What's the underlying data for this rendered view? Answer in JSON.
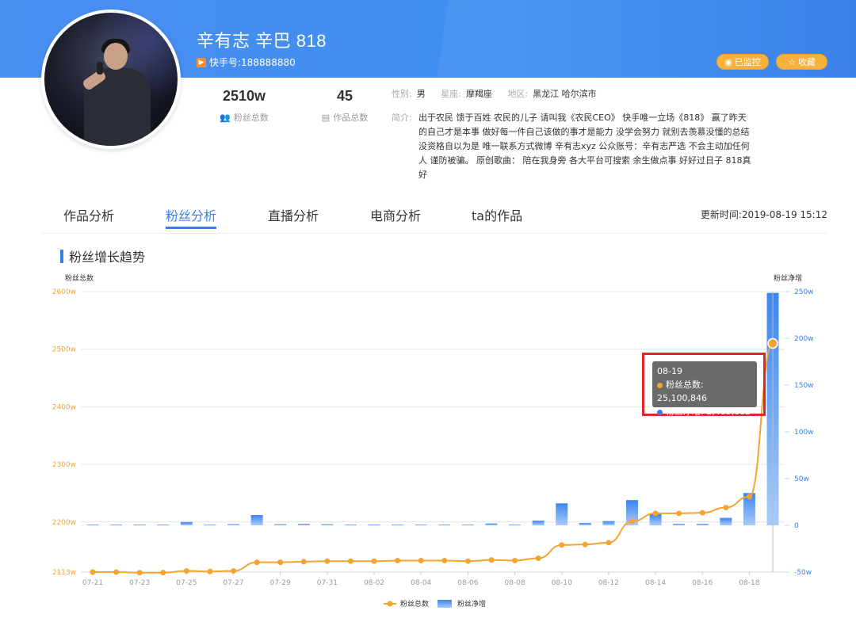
{
  "profile": {
    "name": "辛有志 辛巴 818",
    "kuaishou_label": "快手号:188888880",
    "fans_total": "2510w",
    "fans_total_label": "粉丝总数",
    "works_total": "45",
    "works_total_label": "作品总数",
    "gender_key": "性别:",
    "gender": "男",
    "zodiac_key": "星座:",
    "zodiac": "摩羯座",
    "region_key": "地区:",
    "region": "黑龙江 哈尔滨市",
    "intro_key": "简介:",
    "intro": "出于农民 馈于百姓 农民的儿子 请叫我《农民CEO》 快手唯一立场《818》 赢了昨天的自己才是本事 做好每一件自己该做的事才是能力 没学会努力 就别去羡慕没懂的总结 没资格自以为是 唯一联系方式微博 辛有志xyz 公众账号：辛有志严选 不会主动加任何人 谨防被骗。 原创歌曲： 陪在我身旁 各大平台可搜索 余生做点事 好好过日子 818真好"
  },
  "header": {
    "monitor_label": "已监控",
    "favorite_label": "收藏"
  },
  "tabs": [
    {
      "label": "作品分析"
    },
    {
      "label": "粉丝分析"
    },
    {
      "label": "直播分析"
    },
    {
      "label": "电商分析"
    },
    {
      "label": "ta的作品"
    }
  ],
  "updated_text": "更新时间:2019-08-19 15:12",
  "panel": {
    "title": "粉丝增长趋势"
  },
  "tooltip": {
    "date": "08-19",
    "line1": "粉丝总数: 25,100,846",
    "line2": "粉丝净增: 2,485,682"
  },
  "colors": {
    "accent": "#3a7fe8",
    "line": "#f5a331",
    "bar": "#4a90f0",
    "highlight": "#e0262a"
  },
  "chart_data": {
    "type": "bar-line",
    "x": [
      "07-21",
      "07-22",
      "07-23",
      "07-24",
      "07-25",
      "07-26",
      "07-27",
      "07-28",
      "07-29",
      "07-30",
      "07-31",
      "08-01",
      "08-02",
      "08-03",
      "08-04",
      "08-05",
      "08-06",
      "08-07",
      "08-08",
      "08-09",
      "08-10",
      "08-11",
      "08-12",
      "08-13",
      "08-14",
      "08-15",
      "08-16",
      "08-17",
      "08-18",
      "08-19"
    ],
    "xtick_labels": [
      "07-21",
      "07-23",
      "07-25",
      "07-27",
      "07-29",
      "07-31",
      "08-02",
      "08-04",
      "08-06",
      "08-08",
      "08-10",
      "08-12",
      "08-14",
      "08-16",
      "08-18"
    ],
    "left_axis": {
      "label": "粉丝总数",
      "ticks": [
        "2600w",
        "2500w",
        "2400w",
        "2300w",
        "2200w",
        "2113w"
      ],
      "ylim": [
        2113,
        2600
      ]
    },
    "right_axis": {
      "label": "粉丝净增",
      "ticks": [
        "250w",
        "200w",
        "150w",
        "100w",
        "50w",
        "0",
        "-50w"
      ],
      "ylim": [
        -50,
        250
      ]
    },
    "series": [
      {
        "name": "粉丝总数",
        "type": "line",
        "axis": "left",
        "values": [
          2113,
          2113,
          2112,
          2112,
          2115,
          2114,
          2115,
          2130,
          2130,
          2131,
          2132,
          2132,
          2132,
          2133,
          2133,
          2133,
          2132,
          2134,
          2133,
          2137,
          2160,
          2161,
          2164,
          2201,
          2215,
          2215,
          2216,
          2225,
          2244,
          2510
        ]
      },
      {
        "name": "粉丝净增",
        "type": "bar",
        "axis": "right",
        "values": [
          0.2,
          0.5,
          0.8,
          0.2,
          3.5,
          0.2,
          1.2,
          11,
          1.2,
          1.5,
          1.2,
          0.2,
          0.2,
          0.6,
          0.2,
          0.2,
          0.6,
          2,
          0.5,
          5,
          23.5,
          2.5,
          4.5,
          27,
          12,
          1.5,
          1.5,
          8,
          34.5,
          248.6
        ]
      }
    ],
    "legend": [
      {
        "label": "粉丝总数"
      },
      {
        "label": "粉丝净增"
      }
    ],
    "legend_position": "bottom-center",
    "grid": true
  }
}
